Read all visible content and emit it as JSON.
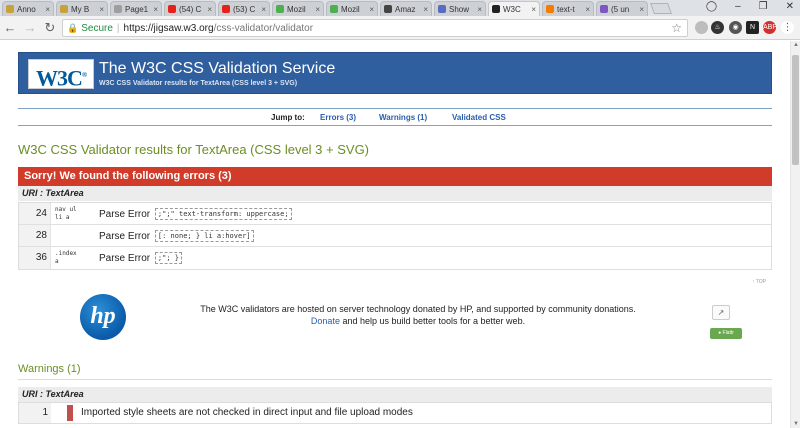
{
  "browser": {
    "tabs": [
      {
        "title": "Anno",
        "favicon_color": "#c7a23a",
        "active": false
      },
      {
        "title": "My B",
        "favicon_color": "#c7a23a",
        "active": false
      },
      {
        "title": "Page1",
        "favicon_color": "#9e9e9e",
        "active": false
      },
      {
        "title": "(54) C",
        "favicon_color": "#e62117",
        "active": false
      },
      {
        "title": "(53) C",
        "favicon_color": "#e62117",
        "active": false
      },
      {
        "title": "Mozil",
        "favicon_color": "#4caf50",
        "active": false
      },
      {
        "title": "Mozil",
        "favicon_color": "#4caf50",
        "active": false
      },
      {
        "title": "Amaz",
        "favicon_color": "#444444",
        "active": false
      },
      {
        "title": "Show",
        "favicon_color": "#5c6bc0",
        "active": false
      },
      {
        "title": "W3C",
        "favicon_color": "#222222",
        "active": true
      },
      {
        "title": "text-t",
        "favicon_color": "#f57c00",
        "active": false
      },
      {
        "title": "(5 un",
        "favicon_color": "#7e57c2",
        "active": false
      }
    ],
    "secure_label": "Secure",
    "url_host": "https://jigsaw.w3.org",
    "url_path": "/css-validator/validator"
  },
  "banner": {
    "logo_text": "W3C",
    "title": "The W3C CSS Validation Service",
    "subtitle": "W3C CSS Validator results for TextArea (CSS level 3 + SVG)"
  },
  "jump": {
    "label": "Jump to:",
    "errors_link": "Errors (3)",
    "warnings_link": "Warnings (1)",
    "validated_link": "Validated CSS"
  },
  "results_title": "W3C CSS Validator results for TextArea (CSS level 3 + SVG)",
  "errors": {
    "heading": "Sorry! We found the following errors (3)",
    "uri_label": "URI : TextArea",
    "rows": [
      {
        "line": "24",
        "context": "nav ul\nli a",
        "message": "Parse Error",
        "code": ";\";\" text-transform: uppercase;"
      },
      {
        "line": "28",
        "context": "",
        "message": "Parse Error",
        "code": "[: none; } li a:hover]"
      },
      {
        "line": "36",
        "context": ".index\na",
        "message": "Parse Error",
        "code": ";\"; }"
      }
    ]
  },
  "top_link": "↑ TOP",
  "sponsor": {
    "logo_text": "hp",
    "line1": "The W3C validators are hosted on server technology donated by HP, and supported by community donations.",
    "donate_link": "Donate",
    "line2_rest": " and help us build better tools for a better web.",
    "flattr_label": "Flattr"
  },
  "warnings": {
    "heading": "Warnings (1)",
    "uri_label": "URI : TextArea",
    "rows": [
      {
        "line": "1",
        "message": "Imported style sheets are not checked in direct input and file upload modes"
      }
    ]
  }
}
